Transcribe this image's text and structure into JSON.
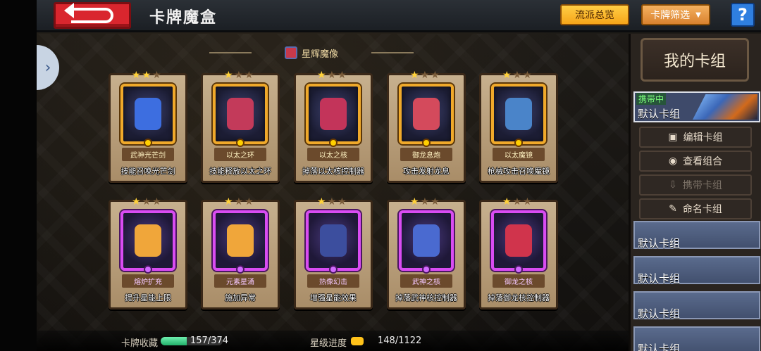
{
  "header": {
    "title": "卡牌魔盒",
    "faction_button": "流派总览",
    "filter_button": "卡牌筛选",
    "help_label": "?"
  },
  "section": {
    "title": "星辉魔像"
  },
  "cards": [
    {
      "name": "武神光芒剑",
      "desc": "技能召唤光芒剑",
      "stars": 2,
      "rarity": "gold",
      "art_color": "#3d6ee0"
    },
    {
      "name": "以太之环",
      "desc": "技能释放以太之环",
      "stars": 1,
      "rarity": "gold",
      "art_color": "#c33a5a"
    },
    {
      "name": "以太之核",
      "desc": "掉落以太核控制器",
      "stars": 1,
      "rarity": "gold",
      "art_color": "#c3345a"
    },
    {
      "name": "御龙息炮",
      "desc": "攻击发射龙息",
      "stars": 1,
      "rarity": "gold",
      "art_color": "#d44a5c"
    },
    {
      "name": "以太魔镜",
      "desc": "枪械攻击召唤魔镜",
      "stars": 1,
      "rarity": "gold",
      "art_color": "#4a84c9"
    },
    {
      "name": "熔炉扩充",
      "desc": "提升星能上限",
      "stars": 1,
      "rarity": "purple",
      "art_color": "#f0a63a"
    },
    {
      "name": "元素星涌",
      "desc": "施加异常",
      "stars": 1,
      "rarity": "purple",
      "art_color": "#f0a63a"
    },
    {
      "name": "热像幻击",
      "desc": "增强星能效果",
      "stars": 1,
      "rarity": "purple",
      "art_color": "#3c4e9e"
    },
    {
      "name": "武神之核",
      "desc": "掉落武神核控制器",
      "stars": 1,
      "rarity": "purple",
      "art_color": "#4a6ad0"
    },
    {
      "name": "御龙之核",
      "desc": "掉落御龙核控制器",
      "stars": 1,
      "rarity": "purple",
      "art_color": "#d0344c"
    }
  ],
  "deck_panel": {
    "title": "我的卡组",
    "active": {
      "tag": "携带中",
      "name": "默认卡组"
    },
    "actions": [
      {
        "label": "编辑卡组",
        "icon": "copy-icon",
        "enabled": true
      },
      {
        "label": "查看组合",
        "icon": "eye-icon",
        "enabled": true
      },
      {
        "label": "携带卡组",
        "icon": "download-icon",
        "enabled": false
      },
      {
        "label": "命名卡组",
        "icon": "pencil-icon",
        "enabled": true
      }
    ],
    "slots": [
      "默认卡组",
      "默认卡组",
      "默认卡组",
      "默认卡组"
    ]
  },
  "stats": {
    "collection_label": "卡牌收藏",
    "collection_value": "157/374",
    "collection_fraction": 0.42,
    "star_label": "星级进度",
    "star_value": "148/1122"
  },
  "colors": {
    "accent_gold": "#f6a51a",
    "back_red": "#d9262e",
    "help_blue": "#2f7fe0",
    "progress_green": "#22b06a"
  }
}
